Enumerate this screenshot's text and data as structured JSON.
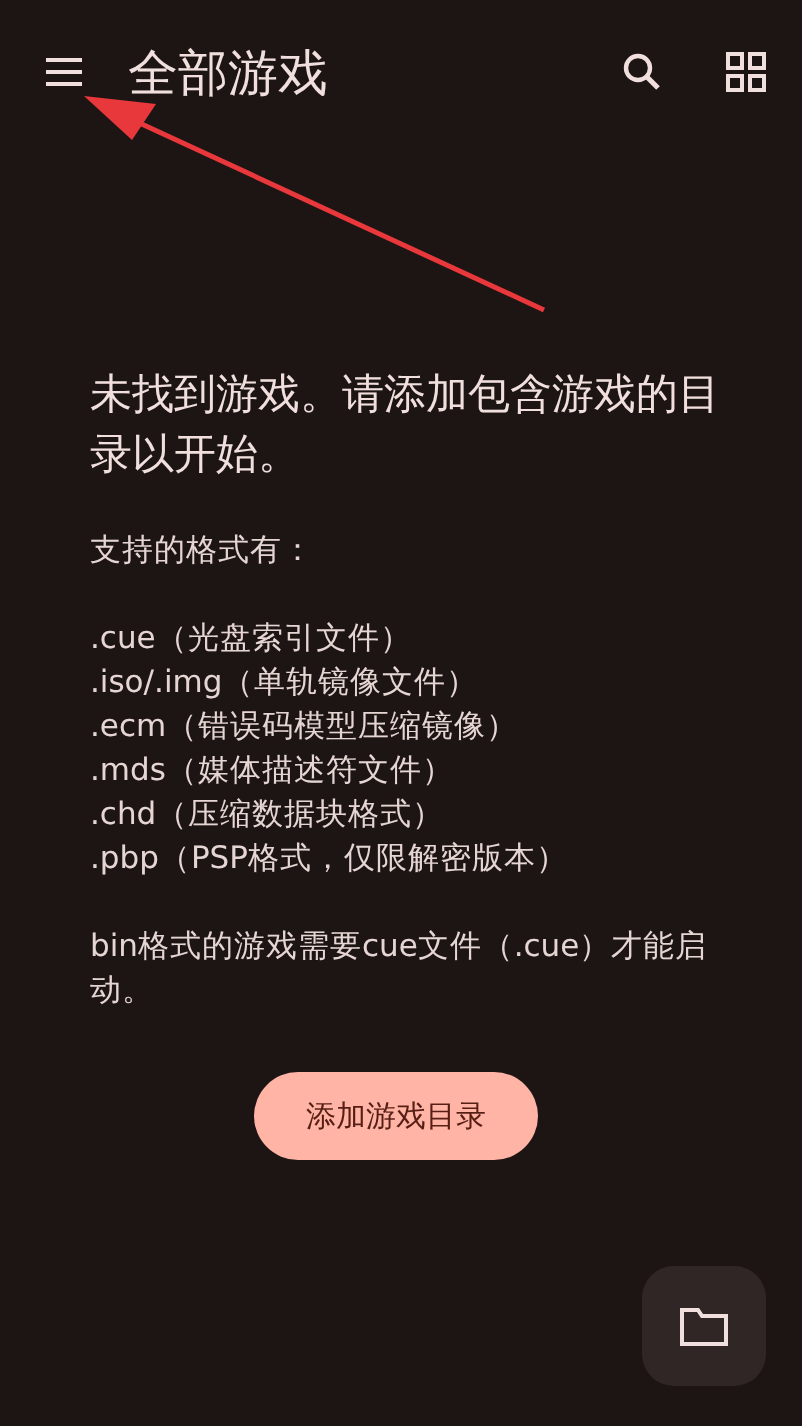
{
  "app_bar": {
    "title": "全部游戏"
  },
  "empty_state": {
    "heading": "未找到游戏。请添加包含游戏的目录以开始。",
    "formats_intro": "支持的格式有：",
    "formats": [
      ".cue（光盘索引文件）",
      ".iso/.img（单轨镜像文件）",
      ".ecm（错误码模型压缩镜像）",
      ".mds（媒体描述符文件）",
      ".chd（压缩数据块格式）",
      ".pbp（PSP格式，仅限解密版本）"
    ],
    "note": "bin格式的游戏需要cue文件（.cue）才能启动。",
    "button": "添加游戏目录"
  }
}
